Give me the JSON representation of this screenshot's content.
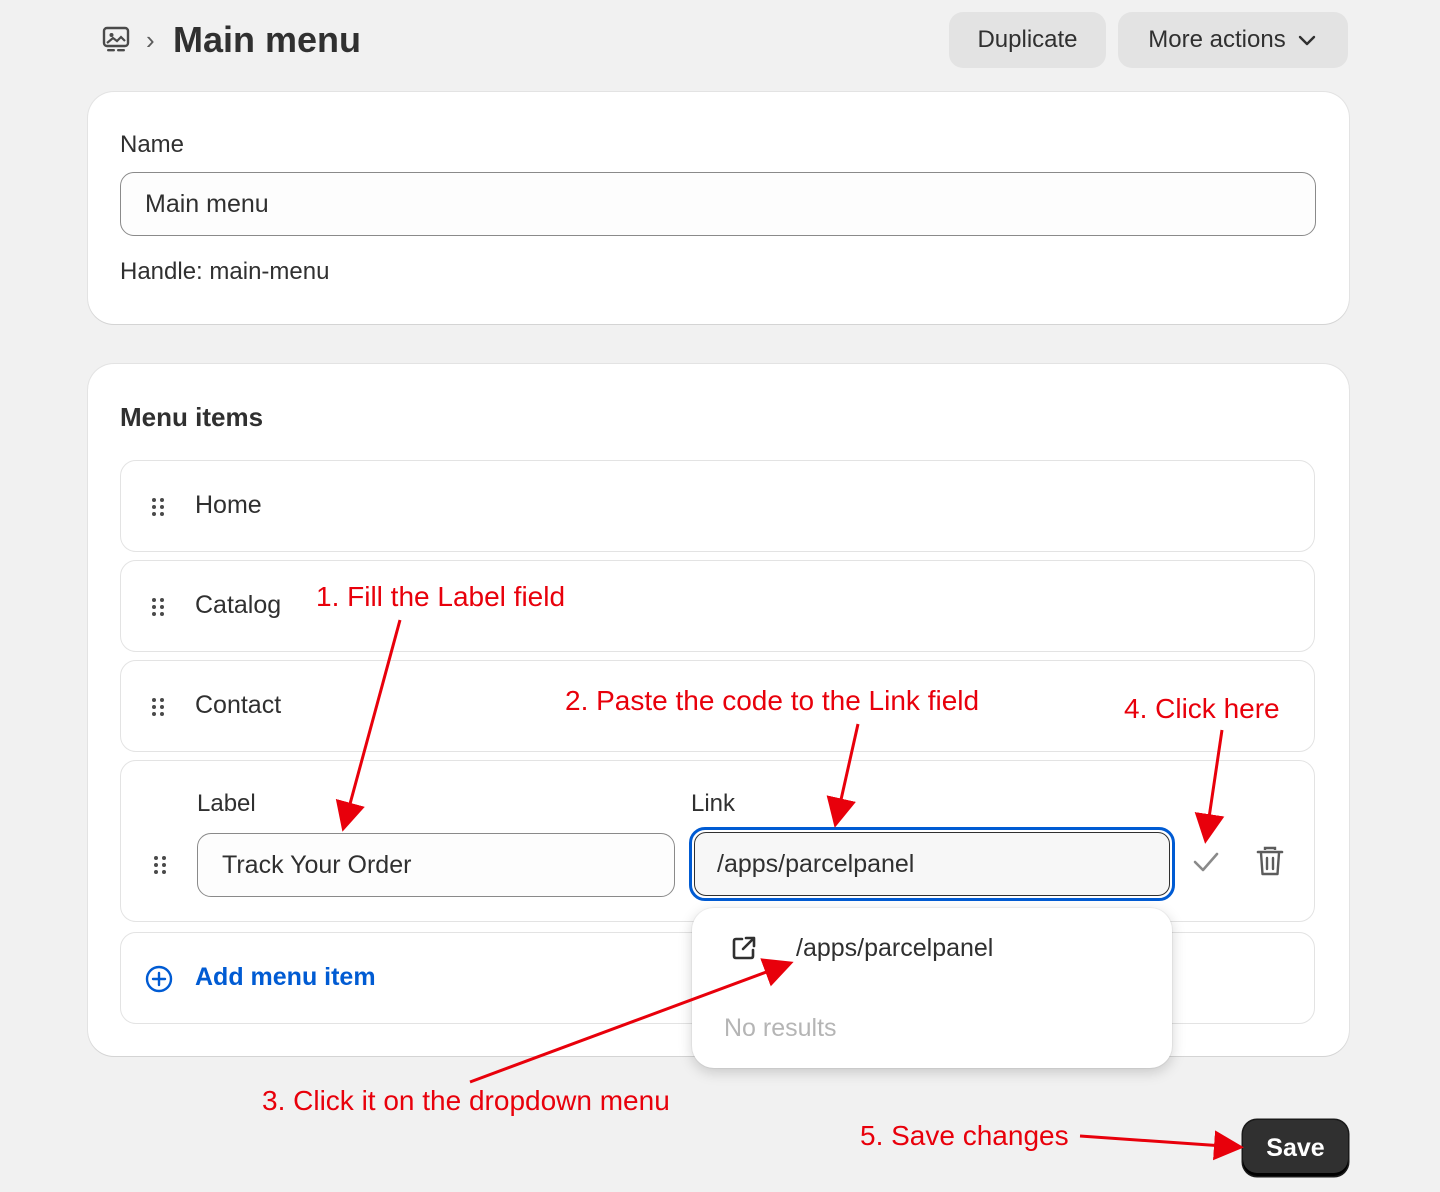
{
  "header": {
    "breadcrumb_separator": "›",
    "title": "Main menu",
    "duplicate_label": "Duplicate",
    "more_actions_label": "More actions"
  },
  "name_card": {
    "name_label": "Name",
    "name_value": "Main menu",
    "handle_text": "Handle: main-menu"
  },
  "menu_card": {
    "title": "Menu items",
    "items": [
      {
        "label": "Home"
      },
      {
        "label": "Catalog"
      },
      {
        "label": "Contact"
      }
    ],
    "edit_item": {
      "label_field_label": "Label",
      "label_value": "Track Your Order",
      "link_field_label": "Link",
      "link_value": "/apps/parcelpanel"
    },
    "add_item_label": "Add menu item"
  },
  "dropdown": {
    "option": "/apps/parcelpanel",
    "empty_text": "No results"
  },
  "save_label": "Save",
  "annotations": {
    "step1": "1. Fill the Label field",
    "step2": "2. Paste the code to the Link field",
    "step3": "3. Click it on the dropdown menu",
    "step4": "4. Click here",
    "step5": "5. Save changes"
  },
  "colors": {
    "accent_blue": "#005bd3",
    "annotation_red": "#e8000b",
    "save_button": "#303030",
    "background": "#f1f1f1"
  },
  "icons": {
    "nav": "online-store-icon",
    "more_actions": "chevron-down-icon",
    "drag": "drag-handle-icon",
    "confirm": "check-icon",
    "delete": "trash-icon",
    "add": "plus-circle-icon",
    "dropdown_option": "external-link-icon"
  }
}
